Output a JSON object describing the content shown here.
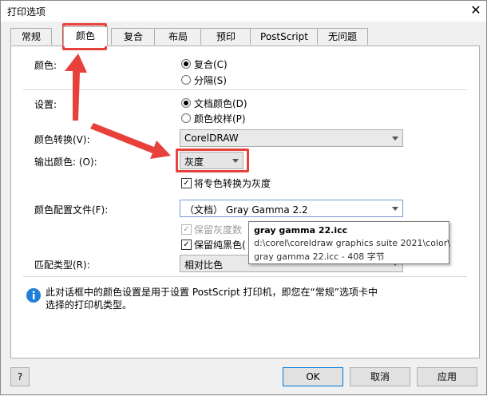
{
  "window": {
    "title": "打印选项",
    "close_glyph": "✕"
  },
  "tabs": [
    "常规",
    "颜色",
    "复合",
    "布局",
    "预印",
    "PostScript",
    "无问题"
  ],
  "color_section": {
    "label": "颜色:",
    "options": [
      "复合(C)",
      "分隔(S)"
    ]
  },
  "settings_section": {
    "label": "设置:",
    "options": [
      "文档颜色(D)",
      "颜色校样(P)"
    ]
  },
  "color_conversion": {
    "label": "颜色转换(V):",
    "value": "CorelDRAW"
  },
  "output_color": {
    "label": "输出颜色: (O):",
    "value": "灰度"
  },
  "spot_to_gray": {
    "label": "将专色转换为灰度"
  },
  "color_profile": {
    "label": "颜色配置文件(F):",
    "value": "（文档）  Gray Gamma 2.2"
  },
  "preserve_gray": {
    "label": "保留灰度数"
  },
  "preserve_black": {
    "label": "保留纯黑色("
  },
  "match_type": {
    "label": "匹配类型(R):",
    "value": "相对比色"
  },
  "tooltip": {
    "title": "gray gamma 22.icc",
    "path": "d:\\corel\\coreldraw graphics suite 2021\\color\\",
    "detail": "gray gamma 22.icc - 408 字节"
  },
  "info": {
    "icon": "info-icon",
    "line1": "此对话框中的颜色设置是用于设置 PostScript 打印机，即您在“常规”选项卡中",
    "line2": "选择的打印机类型。"
  },
  "buttons": {
    "help": "?",
    "ok": "OK",
    "cancel": "取消",
    "apply": "应用"
  },
  "colors": {
    "highlight": "#e8413c",
    "info_blue": "#1e7fd6"
  }
}
